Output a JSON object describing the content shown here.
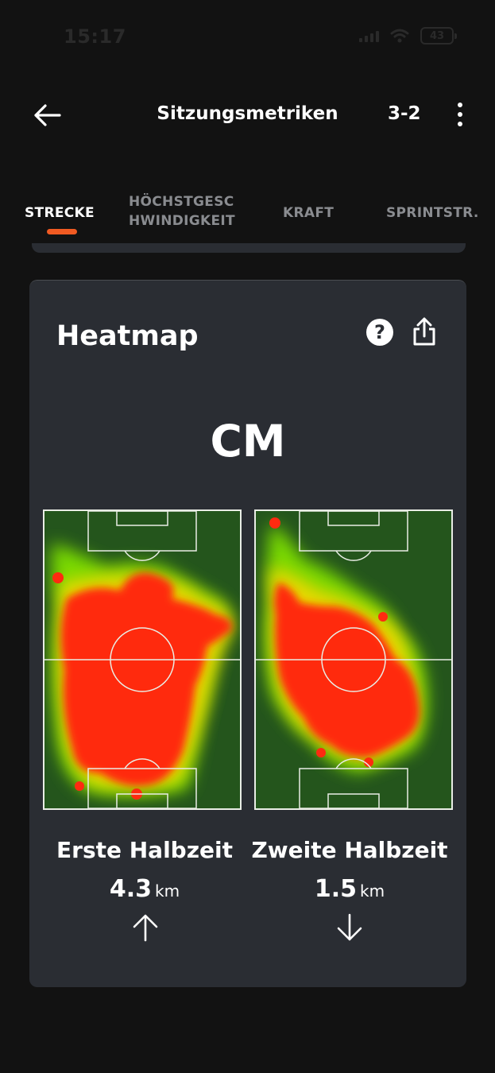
{
  "status_bar": {
    "time": "15:17",
    "battery": "43"
  },
  "header": {
    "title": "Sitzungsmetriken",
    "score": "3-2"
  },
  "tabs": [
    {
      "label": "STRECKE",
      "active": true
    },
    {
      "label_line1": "HÖCHSTGESC",
      "label_line2": "HWINDIGKEIT",
      "active": false
    },
    {
      "label": "KRAFT",
      "active": false
    },
    {
      "label": "SPRINTSTR.",
      "active": false
    }
  ],
  "card": {
    "title": "Heatmap",
    "position": "CM",
    "halves": [
      {
        "label": "Erste Halbzeit",
        "distance": "4.3",
        "unit": "km",
        "trend": "up"
      },
      {
        "label": "Zweite Halbzeit",
        "distance": "1.5",
        "unit": "km",
        "trend": "down"
      }
    ]
  },
  "colors": {
    "accent": "#f05a22",
    "card_bg": "#2a2d33",
    "pitch_green": "#24551c",
    "heat_red": "#ff2a10"
  },
  "icons": [
    "back-arrow-icon",
    "more-vertical-icon",
    "help-icon",
    "share-icon",
    "arrow-up-icon",
    "arrow-down-icon",
    "signal-icon",
    "wifi-icon",
    "battery-icon"
  ]
}
